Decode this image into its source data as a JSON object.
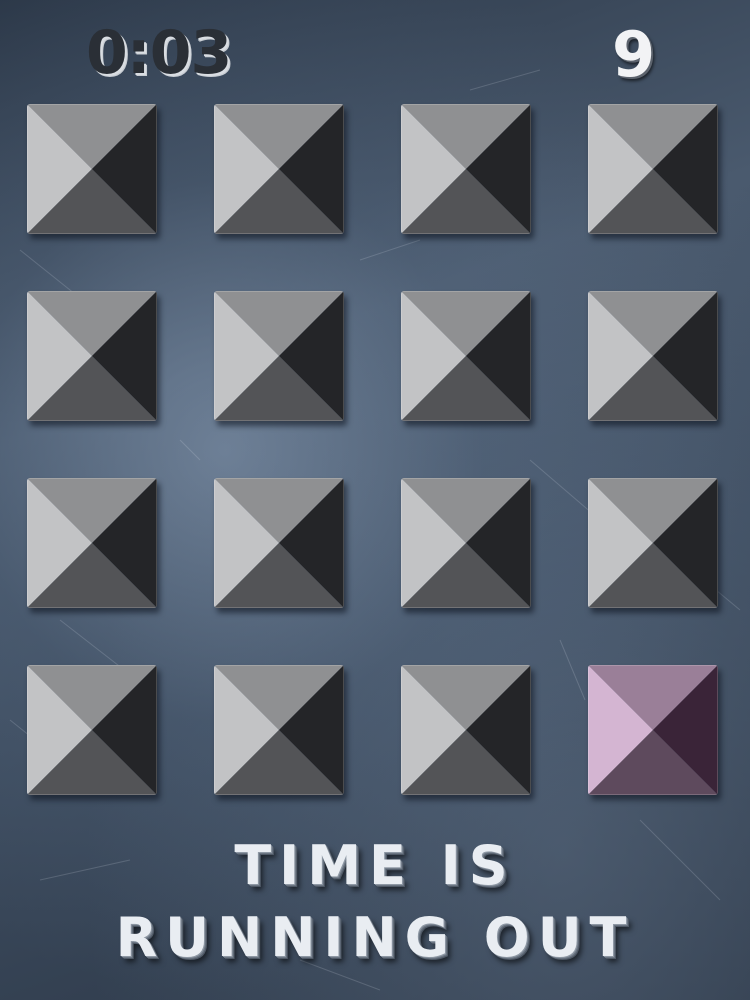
{
  "hud": {
    "timer": "0:03",
    "score": "9"
  },
  "colors": {
    "tile_top": "#8f9092",
    "tile_left": "#c2c3c5",
    "tile_right": "#242528",
    "tile_bottom": "#535457",
    "target_top": "#9a7f98",
    "target_left": "#d4b5d2",
    "target_right": "#3a2438",
    "target_bottom": "#5e4a5d"
  },
  "grid": {
    "rows": 4,
    "cols": 4,
    "highlighted_tile": {
      "row": 4,
      "col": 4
    }
  },
  "message": {
    "line1": "TIME IS",
    "line2": "RUNNING OUT"
  }
}
